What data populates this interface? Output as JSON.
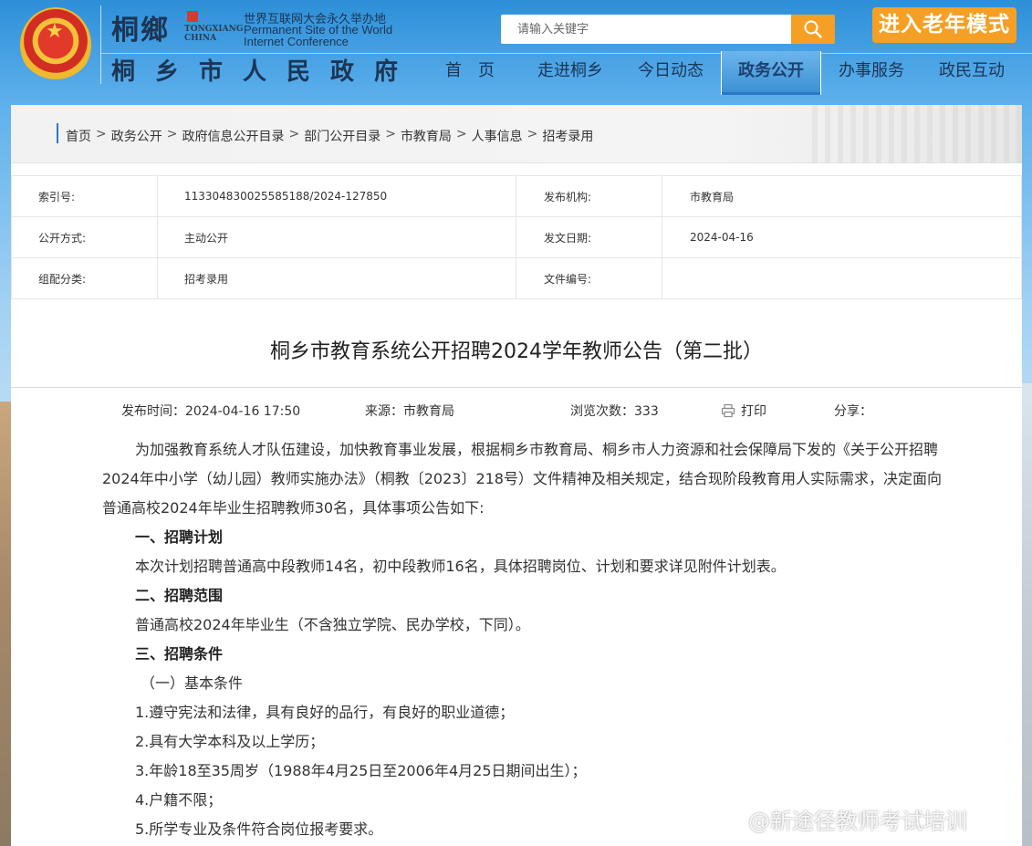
{
  "header": {
    "logo_text": "桐鄉",
    "tongxiang_label": "TONGXIANG CHINA",
    "wic_cn": "世界互联网大会永久举办地",
    "wic_en_1": "Permanent Site of the World",
    "wic_en_2": "Internet Conference",
    "site_title": "桐乡市人民政府",
    "search_placeholder": "请输入关键字",
    "elder_mode_label": "进入老年模式",
    "nav": [
      "首　页",
      "走进桐乡",
      "今日动态",
      "政务公开",
      "办事服务",
      "政民互动"
    ],
    "nav_active_index": 3
  },
  "breadcrumb": [
    "首页",
    "政务公开",
    "政府信息公开目录",
    "部门公开目录",
    "市教育局",
    "人事信息",
    "招考录用"
  ],
  "meta": {
    "rows": [
      {
        "k1": "索引号:",
        "v1": "113304830025585188/2024-127850",
        "k2": "发布机构:",
        "v2": "市教育局"
      },
      {
        "k1": "公开方式:",
        "v1": "主动公开",
        "k2": "发文日期:",
        "v2": "2024-04-16"
      },
      {
        "k1": "组配分类:",
        "v1": "招考录用",
        "k2": "文件编号:",
        "v2": ""
      }
    ]
  },
  "article": {
    "title": "桐乡市教育系统公开招聘2024学年教师公告（第二批）",
    "publish_label": "发布时间：2024-04-16  17:50",
    "source_label": "来源：市教育局",
    "views_label": "浏览次数：333",
    "print_label": "打印",
    "share_label": "分享：",
    "intro": "为加强教育系统人才队伍建设，加快教育事业发展，根据桐乡市教育局、桐乡市人力资源和社会保障局下发的《关于公开招聘2024年中小学（幼儿园）教师实施办法》（桐教〔2023〕218号）文件精神及相关规定，结合现阶段教育用人实际需求，决定面向普通高校2024年毕业生招聘教师30名，具体事项公告如下:",
    "sec1_h": "一、招聘计划",
    "sec1_p": "本次计划招聘普通高中段教师14名，初中段教师16名，具体招聘岗位、计划和要求详见附件计划表。",
    "sec2_h": "二、招聘范围",
    "sec2_p": "普通高校2024年毕业生（不含独立学院、民办学校，下同）。",
    "sec3_h": "三、招聘条件",
    "sec3_sub": "（一）基本条件",
    "items": [
      "1.遵守宪法和法律，具有良好的品行，有良好的职业道德；",
      "2.具有大学本科及以上学历；",
      "3.年龄18至35周岁（1988年4月25日至2006年4月25日期间出生）；",
      "4.户籍不限；",
      "5.所学专业及条件符合岗位报考要求。"
    ]
  },
  "watermark": "@新途径教师考试培训",
  "colors": {
    "accent_orange": "#f5a024",
    "nav_text": "#1c3554",
    "link_blue": "#2b78c4"
  }
}
